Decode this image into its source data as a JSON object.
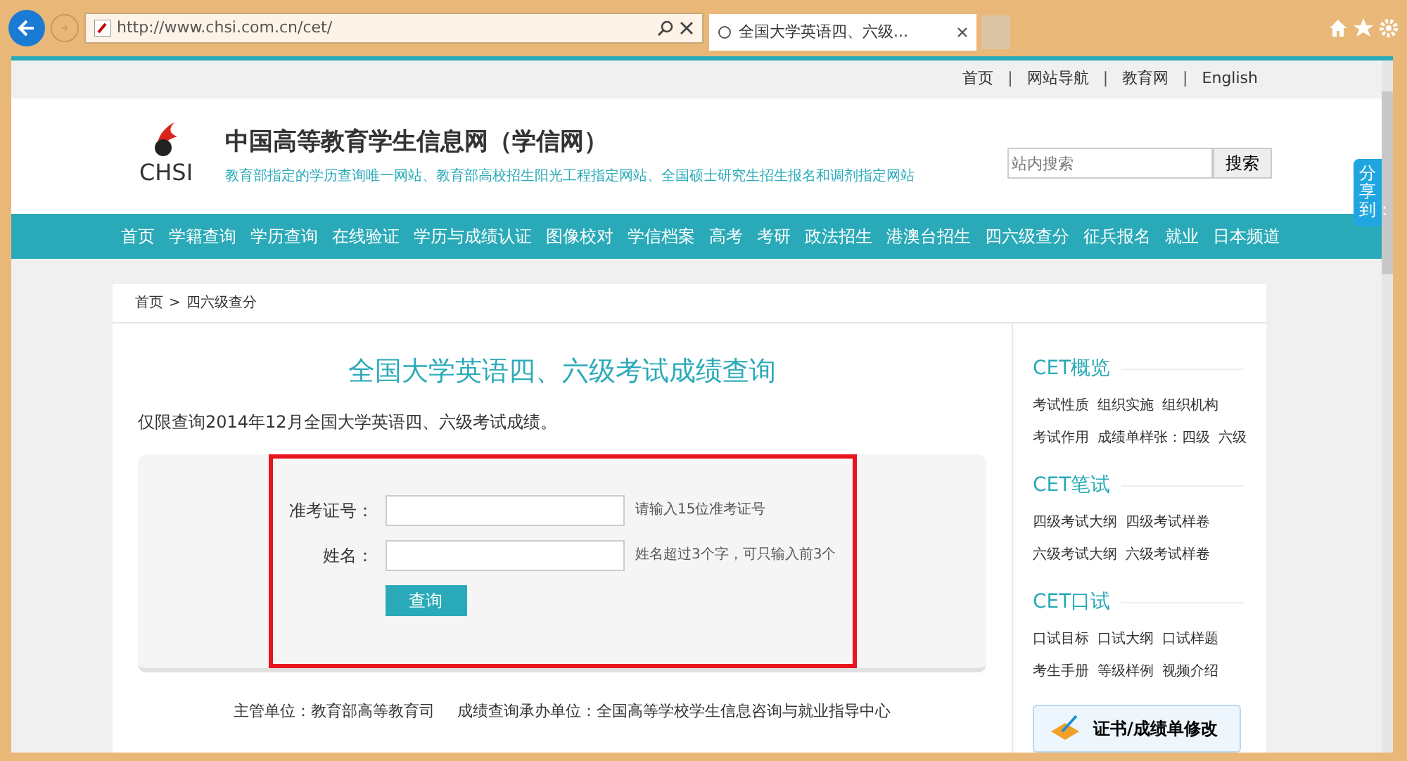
{
  "browser": {
    "url": "http://www.chsi.com.cn/cet/",
    "tab_title": "全国大学英语四、六级..."
  },
  "top_links": [
    "首页",
    "网站导航",
    "教育网",
    "English"
  ],
  "top_separator": "|",
  "site": {
    "title": "中国高等教育学生信息网（学信网）",
    "subtitle": "教育部指定的学历查询唯一网站、教育部高校招生阳光工程指定网站、全国硕士研究生招生报名和调剂指定网站",
    "logo_text": "CHSI"
  },
  "search": {
    "placeholder": "站内搜索",
    "button": "搜索"
  },
  "nav": [
    "首页",
    "学籍查询",
    "学历查询",
    "在线验证",
    "学历与成绩认证",
    "图像校对",
    "学信档案",
    "高考",
    "考研",
    "政法招生",
    "港澳台招生",
    "四六级查分",
    "征兵报名",
    "就业",
    "日本频道"
  ],
  "breadcrumb": {
    "items": [
      "首页",
      "四六级查分"
    ],
    "separator": ">"
  },
  "page_title": "全国大学英语四、六级考试成绩查询",
  "notice": "仅限查询2014年12月全国大学英语四、六级考试成绩。",
  "form": {
    "fields": [
      {
        "label": "准考证号：",
        "hint": "请输入15位准考证号"
      },
      {
        "label": "姓名：",
        "hint": "姓名超过3个字，可只输入前3个"
      }
    ],
    "submit": "查询"
  },
  "footer": [
    "主管单位：教育部高等教育司",
    "成绩查询承办单位：全国高等学校学生信息咨询与就业指导中心"
  ],
  "sidebar": [
    {
      "title": "CET概览",
      "links": [
        "考试性质",
        "组织实施",
        "组织机构",
        "考试作用",
        "成绩单样张：四级",
        "六级"
      ]
    },
    {
      "title": "CET笔试",
      "links": [
        "四级考试大纲",
        "四级考试样卷",
        "六级考试大纲",
        "六级考试样卷"
      ]
    },
    {
      "title": "CET口试",
      "links": [
        "口试目标",
        "口试大纲",
        "口试样题",
        "考生手册",
        "等级样例",
        "视频介绍"
      ]
    }
  ],
  "cert_button": "证书/成绩单修改",
  "share_label": "分享到："
}
